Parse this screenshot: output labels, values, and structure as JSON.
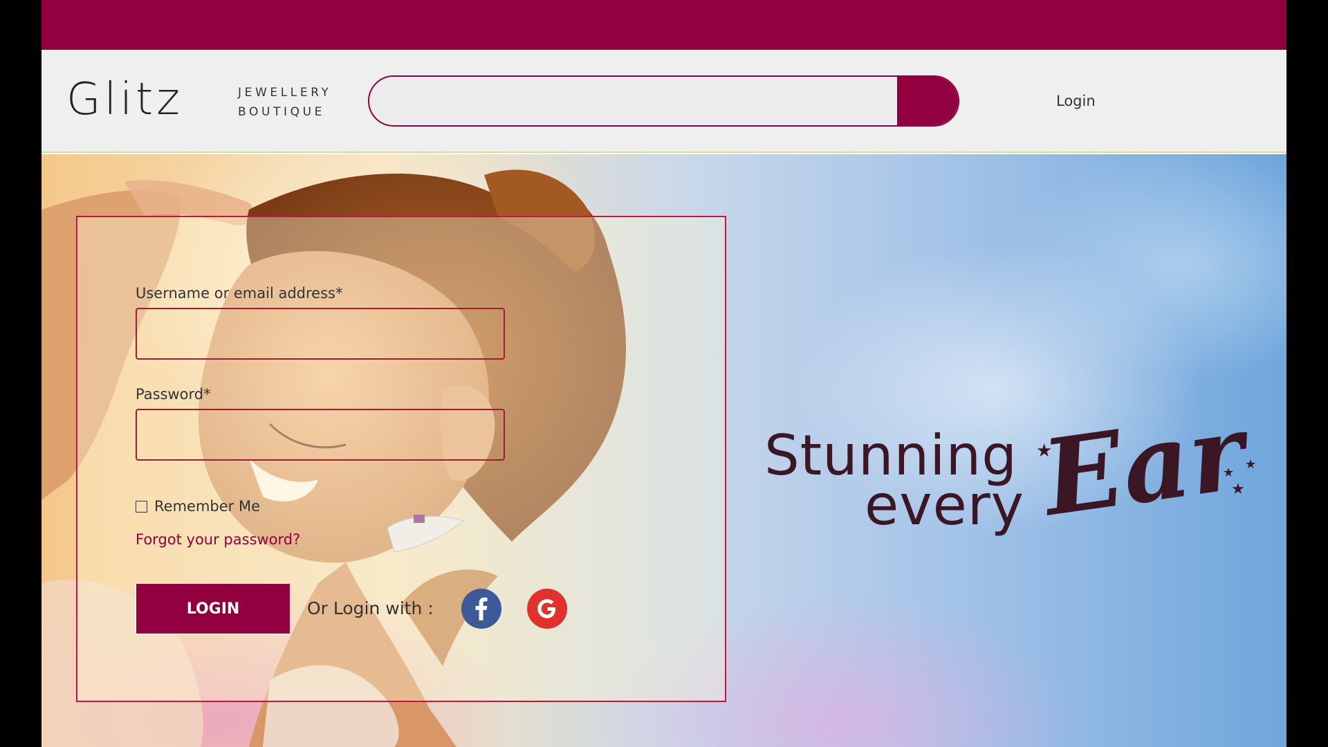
{
  "brand": {
    "name": "Glitz",
    "tagline_line1": "JEWELLERY",
    "tagline_line2": "BOUTIQUE"
  },
  "header": {
    "search_value": "",
    "login_label": "Login"
  },
  "login_form": {
    "username_label": "Username or email address*",
    "username_value": "",
    "password_label": "Password*",
    "password_value": "",
    "remember_label": "Remember Me",
    "remember_checked": false,
    "forgot_label": "Forgot your password?",
    "submit_label": "LOGIN",
    "social_prompt": "Or Login with :",
    "social_providers": [
      "facebook-icon",
      "google-icon"
    ]
  },
  "hero": {
    "headline_part1": "Stunning",
    "headline_part2": "every",
    "headline_part3": "Ear"
  },
  "colors": {
    "brand": "#93003f",
    "facebook": "#3c5a9a",
    "google": "#e2312d",
    "headline": "#3b1624"
  }
}
